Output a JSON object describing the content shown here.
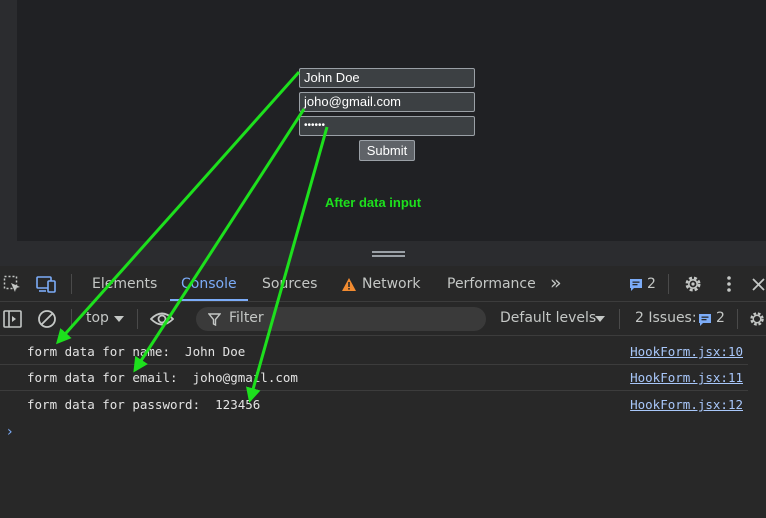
{
  "form": {
    "name_value": "John Doe",
    "email_value": "joho@gmail.com",
    "password_mask": "••••••",
    "submit_label": "Submit"
  },
  "annotation": {
    "text": "After data input"
  },
  "devtools": {
    "tabs": [
      "Elements",
      "Console",
      "Sources",
      "Network",
      "Performance"
    ],
    "active_tab": "Console",
    "messages_badge": "2",
    "more_tabs_glyph": "»"
  },
  "console_toolbar": {
    "context": "top",
    "filter_placeholder": "Filter",
    "levels": "Default levels",
    "issues_label": "2 Issues:",
    "issues_count": "2"
  },
  "console_rows": [
    {
      "message": "form data for name:  John Doe",
      "source": "HookForm.jsx:10"
    },
    {
      "message": "form data for email:  joho@gmail.com",
      "source": "HookForm.jsx:11"
    },
    {
      "message": "form data for password:  123456",
      "source": "HookForm.jsx:12"
    }
  ],
  "prompt_glyph": "›",
  "colors": {
    "accent": "#7cacf8",
    "annotation_green": "#1de01d",
    "network_warning": "#f28b30",
    "link": "#a8c7fa"
  }
}
